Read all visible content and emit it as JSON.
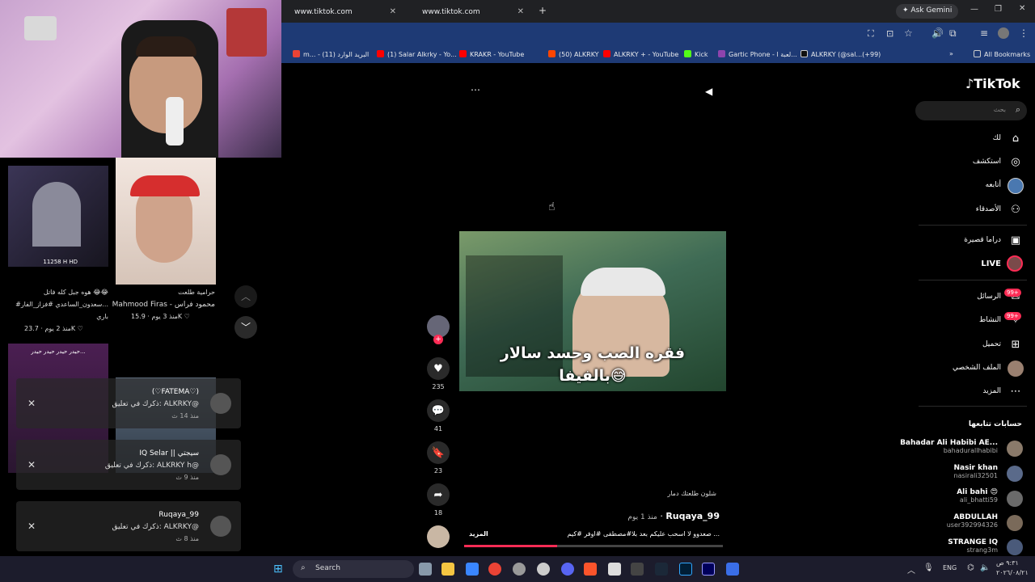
{
  "browser": {
    "tabs": [
      {
        "title": "www.tiktok.com"
      },
      {
        "title": "www.tiktok.com"
      }
    ],
    "ask_gemini": "Ask Gemini",
    "bookmarks": [
      "m... - البريد الوارد (11)",
      "(1) Salar Alkrky - Yo...",
      "KRAKR - YouTube",
      "(50) ALKRKY",
      "ALKRKY + - YouTube",
      "Kick",
      "Gartic Phone - لعبة ا...",
      "ALKRKY (@sal...(+99)"
    ],
    "all_bookmarks": "All Bookmarks"
  },
  "tiktok": {
    "logo": "TikTok",
    "search_placeholder": "بحث",
    "nav": [
      {
        "label": "لك",
        "icon": "home-icon"
      },
      {
        "label": "استكشف",
        "icon": "compass-icon"
      },
      {
        "label": "أتابعه",
        "icon": "avatar-icon"
      },
      {
        "label": "الأصدقاء",
        "icon": "friends-icon"
      },
      {
        "label": "دراما قصيرة",
        "icon": "film-icon"
      },
      {
        "label": "LIVE",
        "icon": "live-icon"
      },
      {
        "label": "الرسائل",
        "icon": "messages-icon",
        "badge": "99+"
      },
      {
        "label": "النشاط",
        "icon": "activity-icon",
        "badge": "99+"
      },
      {
        "label": "تحميل",
        "icon": "upload-icon"
      },
      {
        "label": "الملف الشخصي",
        "icon": "profile-icon"
      },
      {
        "label": "المزيد",
        "icon": "more-icon"
      }
    ],
    "following_title": "حسابات تتابعها",
    "following": [
      {
        "name": "Bahadar Ali Habibi AE...",
        "handle": "bahadurallhabibi"
      },
      {
        "name": "Nasir khan",
        "handle": "nasirali32501"
      },
      {
        "name": "Ali bahi 😍",
        "handle": "ali_bhatti59"
      },
      {
        "name": "ABDULLAH",
        "handle": "user392994326"
      },
      {
        "name": "STRANGE IQ",
        "handle": "strang3m"
      }
    ],
    "video": {
      "caption_line1": "فقره الصب وحسد سالار",
      "caption_line2": "بالفيفا😅",
      "likes": "235",
      "comments": "41",
      "saves": "23",
      "shares": "18",
      "sound": "شلون طلعتك دمار",
      "author": "Ruqaya_99",
      "time_ago": "منذ 1 يوم",
      "description": "صعدوو لا اسحب عليكم بعد بلا#مصطفى #اوفر #كيم ...",
      "more": "المزيد"
    }
  },
  "left_panel": {
    "cards": [
      {
        "title": "هوه جبل كله فاتل 😂😂",
        "subtitle": "#سعدون_الساعدي #فزاز_الفار...",
        "extra": "باري",
        "views": "23.7K",
        "age": "منذ 2 يوم"
      },
      {
        "title": "حرامية طلعت",
        "subtitle": "Mahmood Firas - محمود فراس",
        "extra": "",
        "views": "15.9K",
        "age": "منذ 3 يوم"
      }
    ],
    "card1_badge": "11258 H HD",
    "card3_title": "حيدر حيدر حيدر حيدر...",
    "notifications": [
      {
        "name": "(♡FATEMA♡)",
        "text": "ذكرك في تعليق: ALKRKY@",
        "time": "منذ 14 ث"
      },
      {
        "name": "IQ Selar || سيجتي",
        "text": "ذكرك في تعليق: ALKRKY h@",
        "time": "منذ 9 ث"
      },
      {
        "name": "Ruqaya_99",
        "text": "ذكرك في تعليق: ALKRKY@",
        "time": "منذ 8 ث"
      }
    ]
  },
  "taskbar": {
    "search": "Search",
    "lang": "ENG",
    "time": "٩:٣١ ص",
    "date": "٢٠٢٦/٠٨/٢١"
  }
}
